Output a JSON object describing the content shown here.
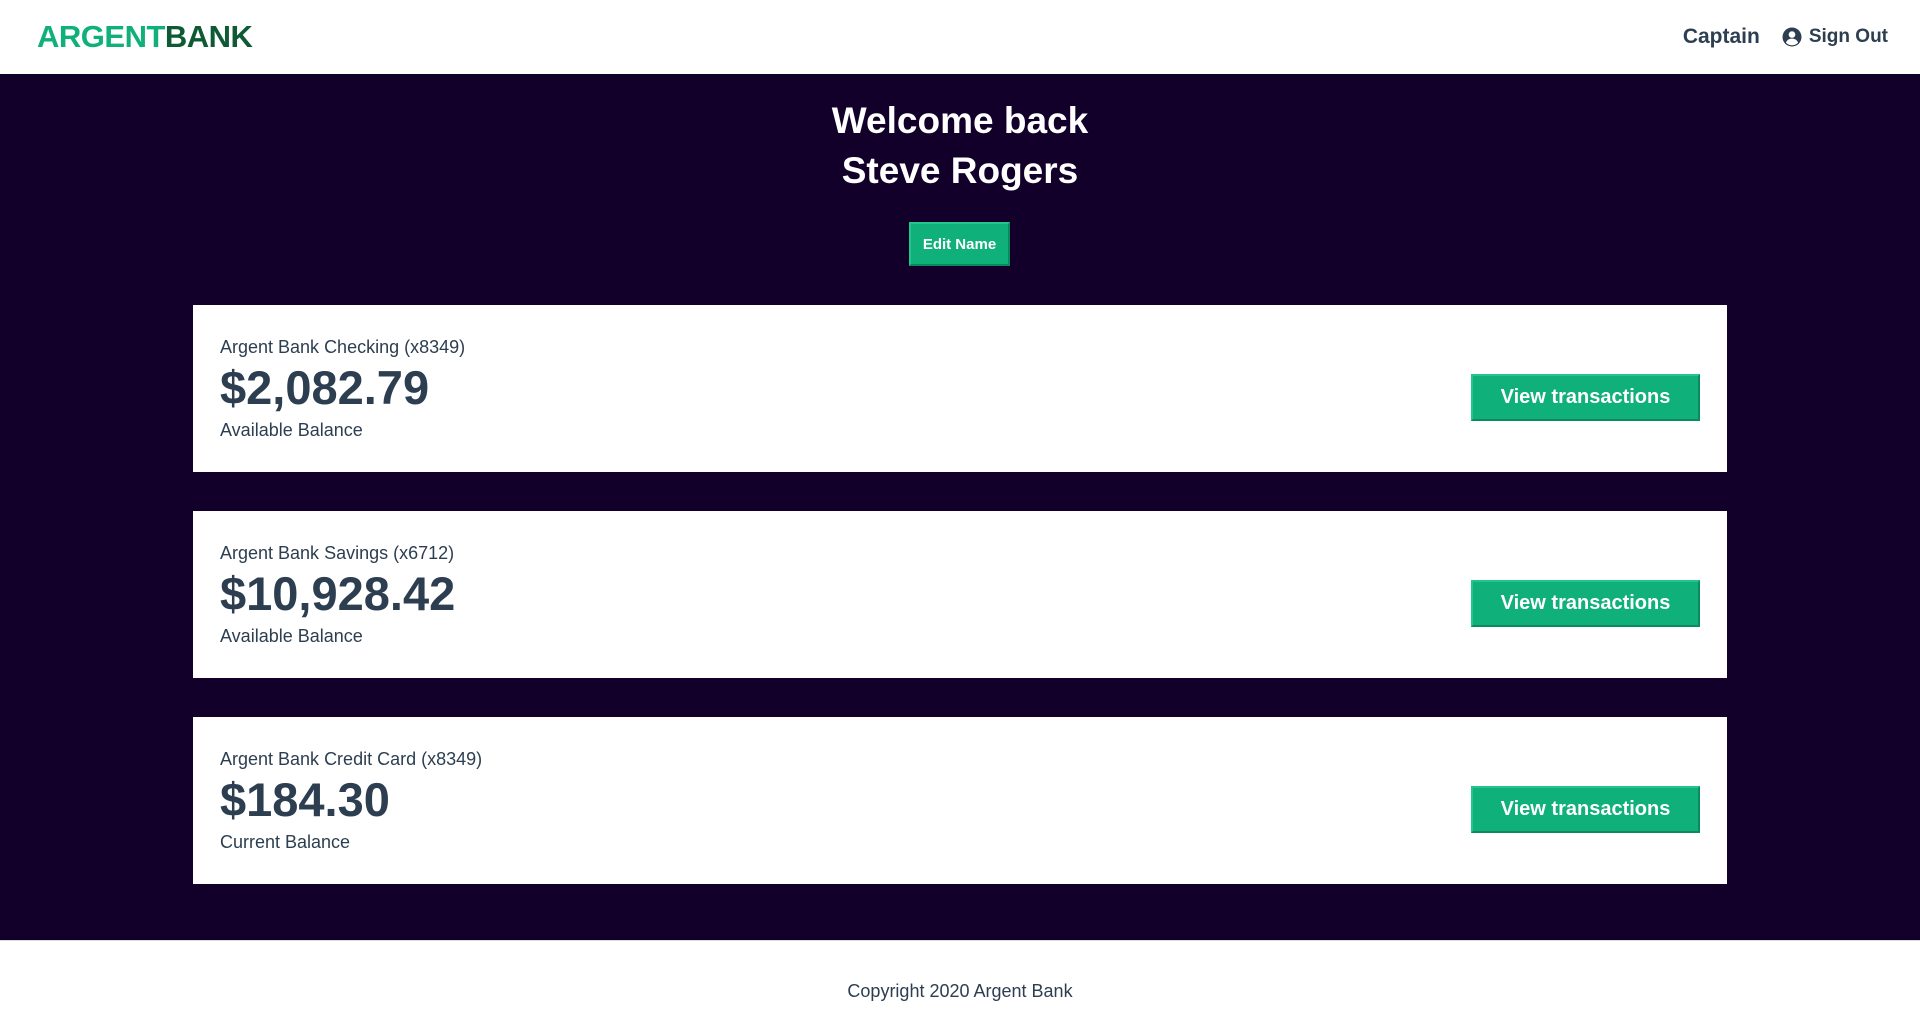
{
  "brand": {
    "part1": "ARGENT",
    "part2": "BANK",
    "color_part1": "#10b07a",
    "color_part2": "#0e5a35"
  },
  "nav": {
    "user_name": "Captain",
    "sign_out": "Sign Out",
    "sign_out_icon": "user-circle-icon"
  },
  "header": {
    "welcome": "Welcome back",
    "user_full_name": "Steve Rogers",
    "edit_button": "Edit Name"
  },
  "accounts": [
    {
      "title": "Argent Bank Checking (x8349)",
      "amount": "$2,082.79",
      "description": "Available Balance",
      "button": "View transactions"
    },
    {
      "title": "Argent Bank Savings (x6712)",
      "amount": "$10,928.42",
      "description": "Available Balance",
      "button": "View transactions"
    },
    {
      "title": "Argent Bank Credit Card (x8349)",
      "amount": "$184.30",
      "description": "Current Balance",
      "button": "View transactions"
    }
  ],
  "footer": {
    "copyright": "Copyright 2020 Argent Bank"
  },
  "colors": {
    "accent": "#10b07a",
    "main_background": "#12002b",
    "text_dark": "#2c3e50"
  }
}
